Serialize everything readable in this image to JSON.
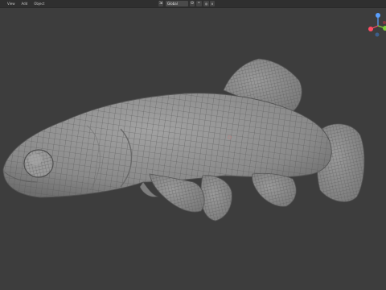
{
  "header": {
    "menu": [
      "View",
      "Add",
      "Object"
    ],
    "transform_orientation": "Global",
    "icons": [
      "transform-orientation-icon",
      "pivot-point-icon",
      "snap-icon",
      "proportional-edit-icon"
    ]
  },
  "viewport": {
    "background": "#3d3d3d",
    "mesh_color": "#8f8f8f",
    "wire_color": "#575757"
  },
  "gizmo": {
    "z_axis_color": "#5aa0ff",
    "x_axis_color": "#ff4c62",
    "y_axis_color": "#7ecf3a",
    "neg_axis_color": "#a0a0a0"
  }
}
